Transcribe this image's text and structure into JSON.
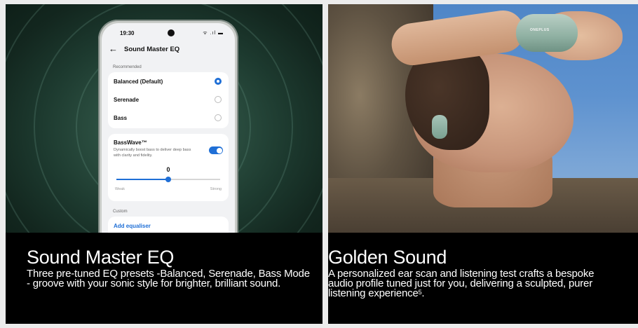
{
  "left_card": {
    "title": "Sound Master EQ",
    "body": "Three pre-tuned EQ presets -Balanced, Serenade, Bass Mode - groove with your sonic style for brighter, brilliant sound.",
    "phone": {
      "time": "19:30",
      "signal_icons": "ᯤ .ıl ▬",
      "screen_title": "Sound Master EQ",
      "recommended_label": "Recommended",
      "presets": [
        {
          "label": "Balanced (Default)",
          "selected": true
        },
        {
          "label": "Serenade",
          "selected": false
        },
        {
          "label": "Bass",
          "selected": false
        }
      ],
      "basswave": {
        "title": "BassWave™",
        "description": "Dynamically boost bass to deliver deep bass with clarity and fidelity.",
        "enabled": true,
        "value": "0",
        "slider_fraction": 0.5,
        "min_label": "Weak",
        "max_label": "Strong"
      },
      "custom_label": "Custom",
      "add_equaliser": "Add equaliser"
    },
    "colors": {
      "accent": "#1f6fd6",
      "background": "#1d3a2f"
    }
  },
  "right_card": {
    "title": "Golden Sound",
    "body": "A personalized ear scan and listening test crafts a bespoke audio profile tuned just for you, delivering a sculpted, purer listening experience",
    "footnote": "5",
    "body_end": ".",
    "case_brand": "ONEPLUS"
  }
}
